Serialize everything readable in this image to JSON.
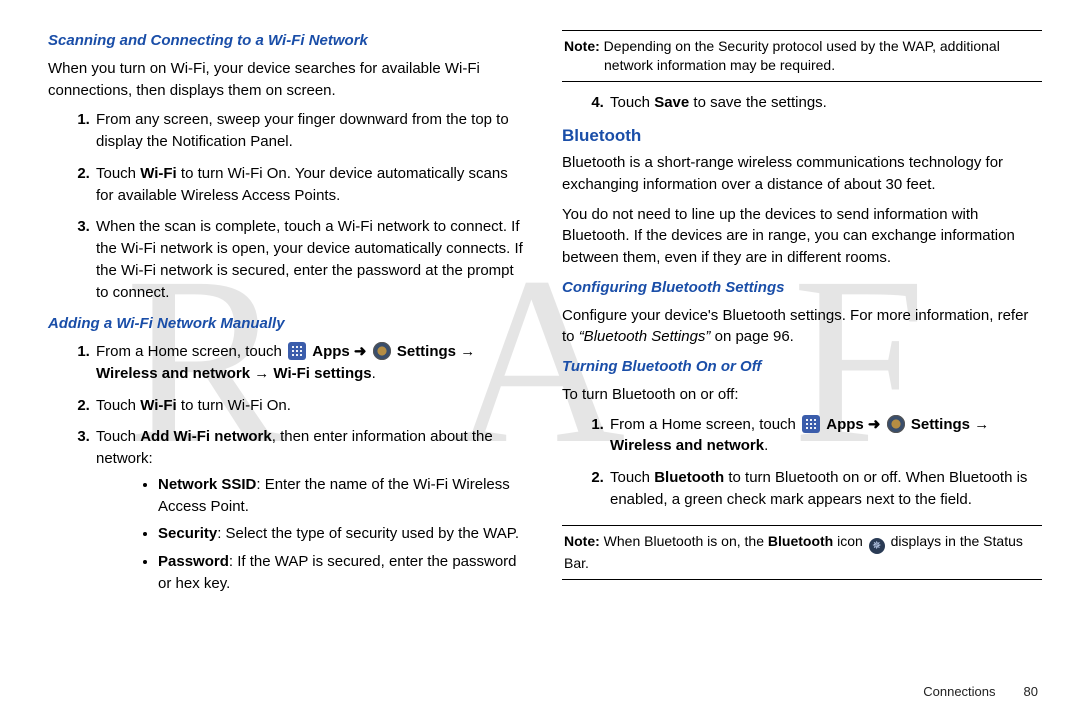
{
  "watermark": "D R A F T",
  "left": {
    "h_scan": "Scanning and Connecting to a Wi-Fi Network",
    "scan_intro": "When you turn on Wi-Fi, your device searches for available Wi-Fi connections, then displays them on screen.",
    "scan_steps": {
      "s1": "From any screen, sweep your finger downward from the top to display the Notification Panel.",
      "s2a": "Touch ",
      "s2b": "Wi-Fi",
      "s2c": " to turn Wi-Fi On. Your device automatically scans for available Wireless Access Points.",
      "s3": "When the scan is complete, touch a Wi-Fi network to connect. If the Wi-Fi network is open, your device automatically connects. If the Wi-Fi network is secured, enter the password at the prompt to connect."
    },
    "h_add": "Adding a Wi-Fi Network Manually",
    "add_steps": {
      "s1a": "From a Home screen, touch ",
      "apps_label": "Apps",
      "arrow": " ➜ ",
      "settings_label": "Settings",
      "s1b": " → Wireless and network → Wi-Fi settings",
      "s1c": ".",
      "s2a": "Touch ",
      "s2b": "Wi-Fi",
      "s2c": " to turn Wi-Fi On.",
      "s3a": "Touch ",
      "s3b": "Add Wi-Fi network",
      "s3c": ", then enter information about the network:",
      "b1a": "Network SSID",
      "b1b": ": Enter the name of the Wi-Fi Wireless Access Point.",
      "b2a": "Security",
      "b2b": ": Select the type of security used by the WAP.",
      "b3a": "Password",
      "b3b": ": If the WAP is secured, enter the password or hex key."
    }
  },
  "right": {
    "note1a": "Note:",
    "note1b": " Depending on the Security protocol used by the WAP, additional",
    "note1c": "network information may be required.",
    "step4a": "Touch ",
    "step4b": "Save",
    "step4c": " to save the settings.",
    "h_bt": "Bluetooth",
    "bt_p1": "Bluetooth is a short-range wireless communications technology for exchanging information over a distance of about 30 feet.",
    "bt_p2": "You do not need to line up the devices to send information with Bluetooth. If the devices are in range, you can exchange information between them, even if they are in different rooms.",
    "h_conf": "Configuring Bluetooth Settings",
    "conf_a": "Configure your device's Bluetooth settings. For more information, refer to ",
    "conf_ref": "“Bluetooth Settings”",
    "conf_b": "  on page 96.",
    "h_turn": "Turning Bluetooth On or Off",
    "turn_intro": "To turn Bluetooth on or off:",
    "turn_s1a": "From a Home screen, touch ",
    "apps_label": "Apps",
    "arrow": " ➜ ",
    "settings_label": "Settings",
    "turn_s1b": " → Wireless and network",
    "turn_s1c": ".",
    "turn_s2a": "Touch ",
    "turn_s2b": "Bluetooth",
    "turn_s2c": " to turn Bluetooth on or off. When Bluetooth is enabled, a green check mark appears next to the field.",
    "note2a": "Note:",
    "note2b": " When Bluetooth is on, the ",
    "note2c": "Bluetooth",
    "note2d": " icon ",
    "note2e": " displays in the Status Bar."
  },
  "footer": {
    "section": "Connections",
    "page": "80"
  }
}
